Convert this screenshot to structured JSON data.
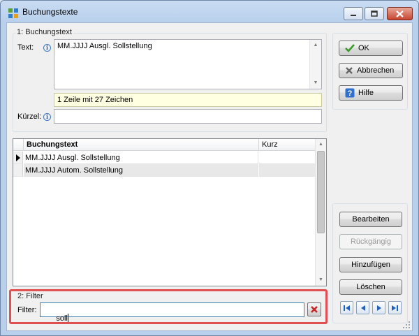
{
  "window": {
    "title": "Buchungstexte"
  },
  "group1": {
    "label": "1: Buchungstext",
    "text_label": "Text:",
    "text_value": "MM.JJJJ Ausgl. Sollstellung",
    "info_bar": "1 Zeile mit 27 Zeichen",
    "kuerzel_label": "Kürzel:",
    "kuerzel_value": ""
  },
  "right_buttons": {
    "ok": "OK",
    "abbrechen": "Abbrechen",
    "hilfe": "Hilfe"
  },
  "grid": {
    "columns": [
      "Buchungstext",
      "Kurz"
    ],
    "rows": [
      {
        "buchungstext": "MM.JJJJ Ausgl. Sollstellung",
        "kurz": "",
        "current": true
      },
      {
        "buchungstext": "MM.JJJJ Autom. Sollstellung",
        "kurz": "",
        "current": false
      }
    ]
  },
  "action_buttons": {
    "bearbeiten": "Bearbeiten",
    "rueckgaengig": "Rückgängig",
    "hinzufuegen": "Hinzufügen",
    "loeschen": "Löschen"
  },
  "filter": {
    "group_label": "2: Filter",
    "label": "Filter:",
    "value": "soll"
  },
  "colors": {
    "highlight": "#e05050",
    "info_bar_bg": "#ffffe1",
    "clear_icon": "#c62828",
    "nav_arrow": "#1f5fbf"
  },
  "icons": [
    "app-icon",
    "minimize-icon",
    "maximize-icon",
    "close-icon",
    "info-icon",
    "checkmark-icon",
    "cancel-x-icon",
    "help-question-icon",
    "clear-filter-icon",
    "first-record-icon",
    "previous-record-icon",
    "next-record-icon",
    "last-record-icon",
    "size-grip-icon"
  ]
}
